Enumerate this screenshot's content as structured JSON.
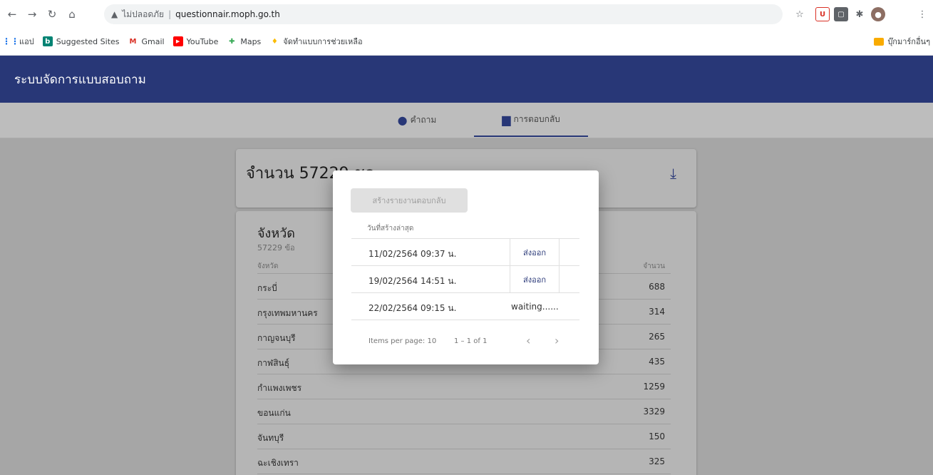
{
  "browser": {
    "url_status": "ไม่ปลอดภัย",
    "url": "questionnair.moph.go.th",
    "bookmarks": [
      {
        "label": "แอป",
        "icon": "apps-icon"
      },
      {
        "label": "Suggested Sites",
        "icon": "bing-icon"
      },
      {
        "label": "Gmail",
        "icon": "gmail-icon"
      },
      {
        "label": "YouTube",
        "icon": "youtube-icon"
      },
      {
        "label": "Maps",
        "icon": "maps-icon"
      },
      {
        "label": "จัดทำแบบการช่วยเหลือ",
        "icon": "bookmark-icon"
      }
    ],
    "other_bookmarks": "บุ๊กมาร์กอื่นๆ"
  },
  "app": {
    "title": "ระบบจัดการแบบสอบถาม",
    "tabs": [
      {
        "label": "คำถาม",
        "icon": "help-icon"
      },
      {
        "label": "การตอบกลับ",
        "icon": "forum-icon"
      }
    ]
  },
  "summary": {
    "count_text": "จำนวน 57229 ชุด"
  },
  "province_table": {
    "title": "จังหวัด",
    "subtitle": "57229 ข้อ",
    "columns": [
      "จังหวัด",
      "จำนวน"
    ],
    "rows": [
      {
        "name": "กระบี่",
        "value": "688"
      },
      {
        "name": "กรุงเทพมหานคร",
        "value": "314"
      },
      {
        "name": "กาญจนบุรี",
        "value": "265"
      },
      {
        "name": "กาฬสินธุ์",
        "value": "435"
      },
      {
        "name": "กำแพงเพชร",
        "value": "1259"
      },
      {
        "name": "ขอนแก่น",
        "value": "3329"
      },
      {
        "name": "จันทบุรี",
        "value": "150"
      },
      {
        "name": "ฉะเชิงเทรา",
        "value": "325"
      }
    ]
  },
  "dialog": {
    "create_button": "สร้างรายงานตอบกลับ",
    "column_header": "วันที่สร้างล่าสุด",
    "exports": [
      {
        "date": "11/02/2564 09:37 น.",
        "action": "ส่งออก",
        "status": "ready"
      },
      {
        "date": "19/02/2564 14:51 น.",
        "action": "ส่งออก",
        "status": "ready"
      },
      {
        "date": "22/02/2564 09:15 น.",
        "action": "waiting......",
        "status": "waiting"
      }
    ],
    "paginator": {
      "items_per_page_label": "Items per page: 10",
      "range_label": "1 – 1 of 1"
    }
  }
}
